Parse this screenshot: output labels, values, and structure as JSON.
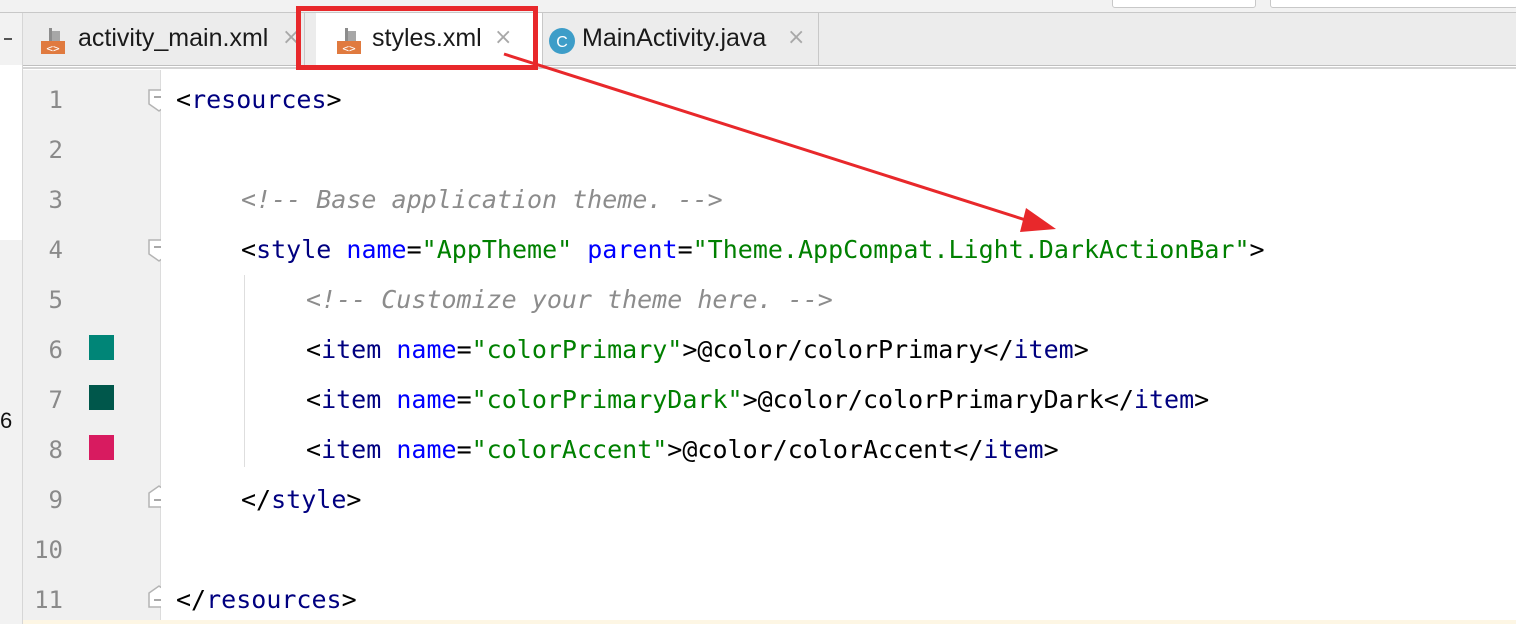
{
  "tabs": [
    {
      "label": "activity_main.xml",
      "icon": "xml-file-icon",
      "active": false
    },
    {
      "label": "styles.xml",
      "icon": "xml-file-icon",
      "active": true
    },
    {
      "label": "MainActivity.java",
      "icon": "java-class-icon",
      "active": false
    }
  ],
  "close_glyph": "×",
  "class_icon_letter": "C",
  "left_panel": {
    "count": "6"
  },
  "line_numbers": [
    "1",
    "2",
    "3",
    "4",
    "5",
    "6",
    "7",
    "8",
    "9",
    "10",
    "11"
  ],
  "code": {
    "l1": {
      "open": "<",
      "tag": "resources",
      "close": ">"
    },
    "l3": {
      "comment": "<!-- Base application theme. -->"
    },
    "l4": {
      "open": "<",
      "tag": "style",
      "attr1": "name",
      "eq1": "=",
      "val1": "\"AppTheme\"",
      "attr2": "parent",
      "eq2": "=",
      "val2": "\"Theme.AppCompat.Light.DarkActionBar\"",
      "close": ">"
    },
    "l5": {
      "comment": "<!-- Customize your theme here. -->"
    },
    "l6": {
      "open": "<",
      "tag": "item",
      "attr": "name",
      "eq": "=",
      "val": "\"colorPrimary\"",
      "gt": ">",
      "text": "@color/colorPrimary",
      "end_open": "</",
      "end_tag": "item",
      "end_close": ">"
    },
    "l7": {
      "open": "<",
      "tag": "item",
      "attr": "name",
      "eq": "=",
      "val": "\"colorPrimaryDark\"",
      "gt": ">",
      "text": "@color/colorPrimaryDark",
      "end_open": "</",
      "end_tag": "item",
      "end_close": ">"
    },
    "l8": {
      "open": "<",
      "tag": "item",
      "attr": "name",
      "eq": "=",
      "val": "\"colorAccent\"",
      "gt": ">",
      "text": "@color/colorAccent",
      "end_open": "</",
      "end_tag": "item",
      "end_close": ">"
    },
    "l9": {
      "open": "</",
      "tag": "style",
      "close": ">"
    },
    "l11": {
      "open": "</",
      "tag": "resources",
      "close": ">"
    }
  },
  "swatches": [
    {
      "line": "6",
      "color": "#008577"
    },
    {
      "line": "7",
      "color": "#00574B"
    },
    {
      "line": "8",
      "color": "#D81B60"
    }
  ],
  "annotation": {
    "highlight_color": "#e8282b",
    "target": "styles.xml"
  }
}
